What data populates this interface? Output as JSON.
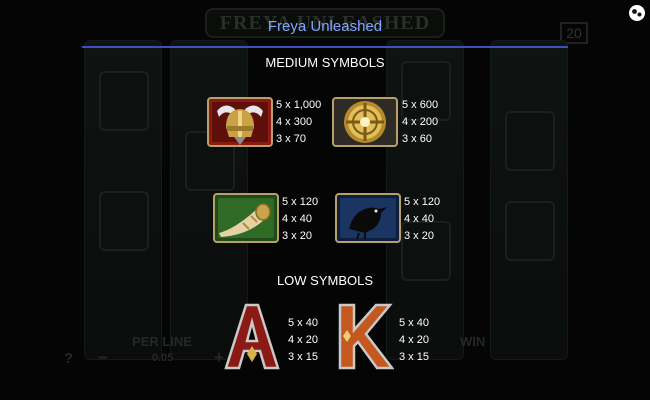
{
  "background": {
    "game_title": "FREYA UNLEASHED",
    "bet_badge": "20",
    "per_line_label": "PER LINE",
    "per_line_value": "0.05",
    "win_label": "WIN",
    "help_label": "?",
    "minus_label": "−",
    "plus_label": "+"
  },
  "header": {
    "title": "Freya Unleashed",
    "accent_color": "#3f4fbf"
  },
  "medium_symbols": {
    "title": "MEDIUM SYMBOLS",
    "items": [
      {
        "icon": "viking-helmet-icon",
        "payouts": [
          "5 x 1,000",
          "4 x 300",
          "3 x 70"
        ]
      },
      {
        "icon": "golden-shield-icon",
        "payouts": [
          "5 x 600",
          "4 x 200",
          "3 x 60"
        ]
      },
      {
        "icon": "drinking-horn-icon",
        "payouts": [
          "5 x 120",
          "4 x 40",
          "3 x 20"
        ]
      },
      {
        "icon": "raven-icon",
        "payouts": [
          "5 x 120",
          "4 x 40",
          "3 x 20"
        ]
      }
    ]
  },
  "low_symbols": {
    "title": "LOW SYMBOLS",
    "items": [
      {
        "icon": "letter-a-icon",
        "glyph": "A",
        "payouts": [
          "5 x 40",
          "4 x 20",
          "3 x 15"
        ]
      },
      {
        "icon": "letter-k-icon",
        "glyph": "K",
        "payouts": [
          "5 x 40",
          "4 x 20",
          "3 x 15"
        ]
      }
    ]
  }
}
